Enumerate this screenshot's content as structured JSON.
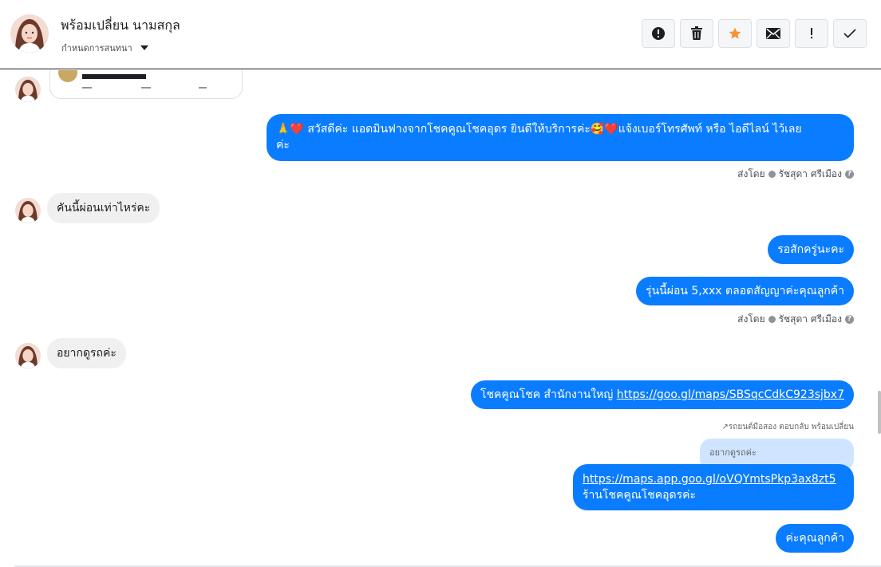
{
  "header": {
    "contact_name": "พร้อมเปลี่ยน นามสกุล",
    "assign_label": "กำหนดการสนทนา",
    "tools": [
      {
        "name": "alert-circle-icon"
      },
      {
        "name": "trash-icon"
      },
      {
        "name": "star-icon",
        "color": "#f7923a"
      },
      {
        "name": "mail-icon"
      },
      {
        "name": "exclamation-icon"
      },
      {
        "name": "check-icon"
      }
    ]
  },
  "messages": {
    "out1_line1": "🙏❤️ สวัสดีค่ะ แอดมินฟางจากโชคคูณโชคอุดร ยินดีให้บริการค่ะ🥰❤️แจ้งเบอร์โทรศัพท์ หรือ ไอดีไลน์  ไว้เลย",
    "out1_line2": "ค่ะ",
    "sent_by_label": "ส่งโดย",
    "sender_name": "รัชสุดา ศรีเมือง",
    "in1": "คันนี้ผ่อนเท่าไหร่คะ",
    "out2": "รอสักครู่นะคะ",
    "out3": "รุ่นนี้ผ่อน  5,xxx ตลอดสัญญาค่ะคุณลูกค้า",
    "in2": "อยากดูรถค่ะ",
    "out4_text": "โชคคูณโชค สำนักงานใหญ่ ",
    "out4_link": "https://goo.gl/maps/SBSqcCdkC923sjbx7",
    "reply_meta": "↗รถยนต์มือสอง ตอบกลับ พร้อมเปลี่ยน",
    "quoted": "อยากดูรถค่ะ",
    "out5_link": "https://maps.app.goo.gl/oVQYmtsPkp3ax8zt5",
    "out5_text": "ร้านโชคคูณโชคอุดรค่ะ",
    "out6": "ค่ะคุณลูกค้า"
  },
  "colors": {
    "outgoing": "#0a7cff",
    "incoming": "#f0f0f0"
  }
}
